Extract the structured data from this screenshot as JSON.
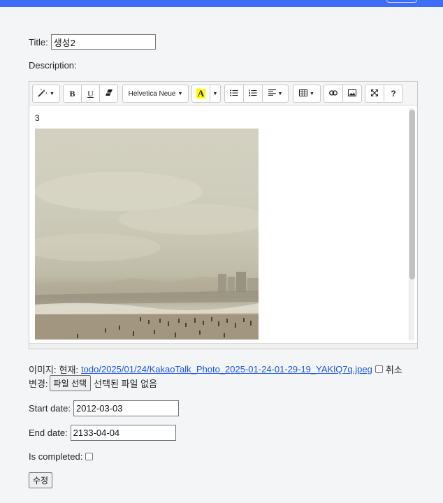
{
  "form": {
    "title_label": "Title:",
    "title_value": "생성2",
    "description_label": "Description:",
    "editor": {
      "toolbar": {
        "font_name": "Helvetica Neue",
        "font_color_letter": "A",
        "bold": "B",
        "underline": "U",
        "help": "?"
      },
      "content_text": "3"
    },
    "image": {
      "label": "이미지:",
      "current_label": "현재:",
      "current_link": "todo/2025/01/24/KakaoTalk_Photo_2025-01-24-01-29-19_YAKlQ7q.jpeg",
      "clear_label": "취소",
      "change_label": "변경:",
      "choose_file_button": "파일 선택",
      "no_file_text": "선택된 파일 없음"
    },
    "start_date_label": "Start date:",
    "start_date_value": "2012-03-03",
    "end_date_label": "End date:",
    "end_date_value": "2133-04-04",
    "is_completed_label": "Is completed:",
    "submit_label": "수정"
  },
  "colors": {
    "topbar": "#3d6ef5",
    "link": "#1a55e3",
    "page_bg": "#f4f5f7"
  }
}
